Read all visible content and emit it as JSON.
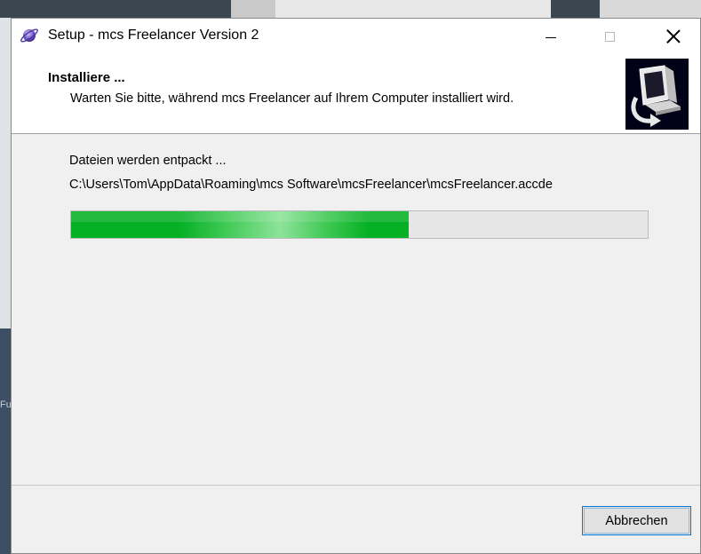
{
  "window": {
    "title": "Setup - mcs Freelancer Version 2",
    "icon": "planet-icon"
  },
  "header": {
    "title": "Installiere ...",
    "subtitle": "Warten Sie bitte, während mcs Freelancer auf Ihrem Computer installiert wird.",
    "image": "computer-install-icon"
  },
  "main": {
    "status": "Dateien werden entpackt ...",
    "path": "C:\\Users\\Tom\\AppData\\Roaming\\mcs Software\\mcsFreelancer\\mcsFreelancer.accde",
    "progress": 0.585,
    "progress_color": "#06b025"
  },
  "footer": {
    "cancel_label": "Abbrechen"
  },
  "background": {
    "left_fragment": "Fu"
  }
}
